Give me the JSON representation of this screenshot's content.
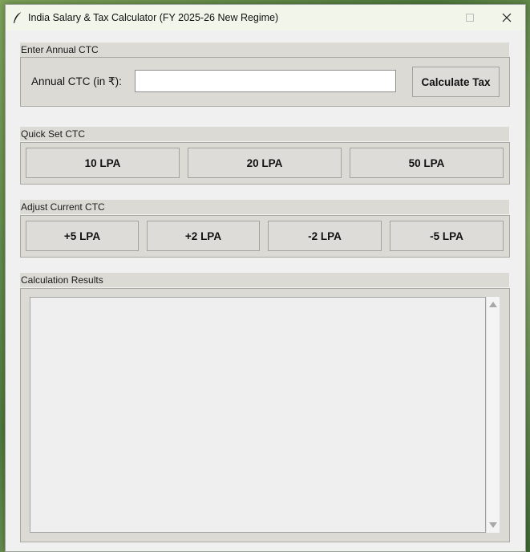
{
  "window": {
    "title": "India Salary & Tax Calculator (FY 2025-26 New Regime)"
  },
  "ctc_section": {
    "label": "Enter Annual CTC",
    "field_label": "Annual CTC (in ₹):",
    "input_value": "",
    "calculate_label": "Calculate Tax"
  },
  "quick_set": {
    "label": "Quick Set CTC",
    "buttons": [
      "10 LPA",
      "20 LPA",
      "50 LPA"
    ]
  },
  "adjust": {
    "label": "Adjust Current CTC",
    "buttons": [
      "+5 LPA",
      "+2 LPA",
      "-2 LPA",
      "-5 LPA"
    ]
  },
  "results": {
    "label": "Calculation Results",
    "text": ""
  },
  "icons": {
    "app": "feather-icon",
    "minimize": "minimize-icon",
    "maximize": "maximize-icon",
    "close": "close-icon"
  }
}
